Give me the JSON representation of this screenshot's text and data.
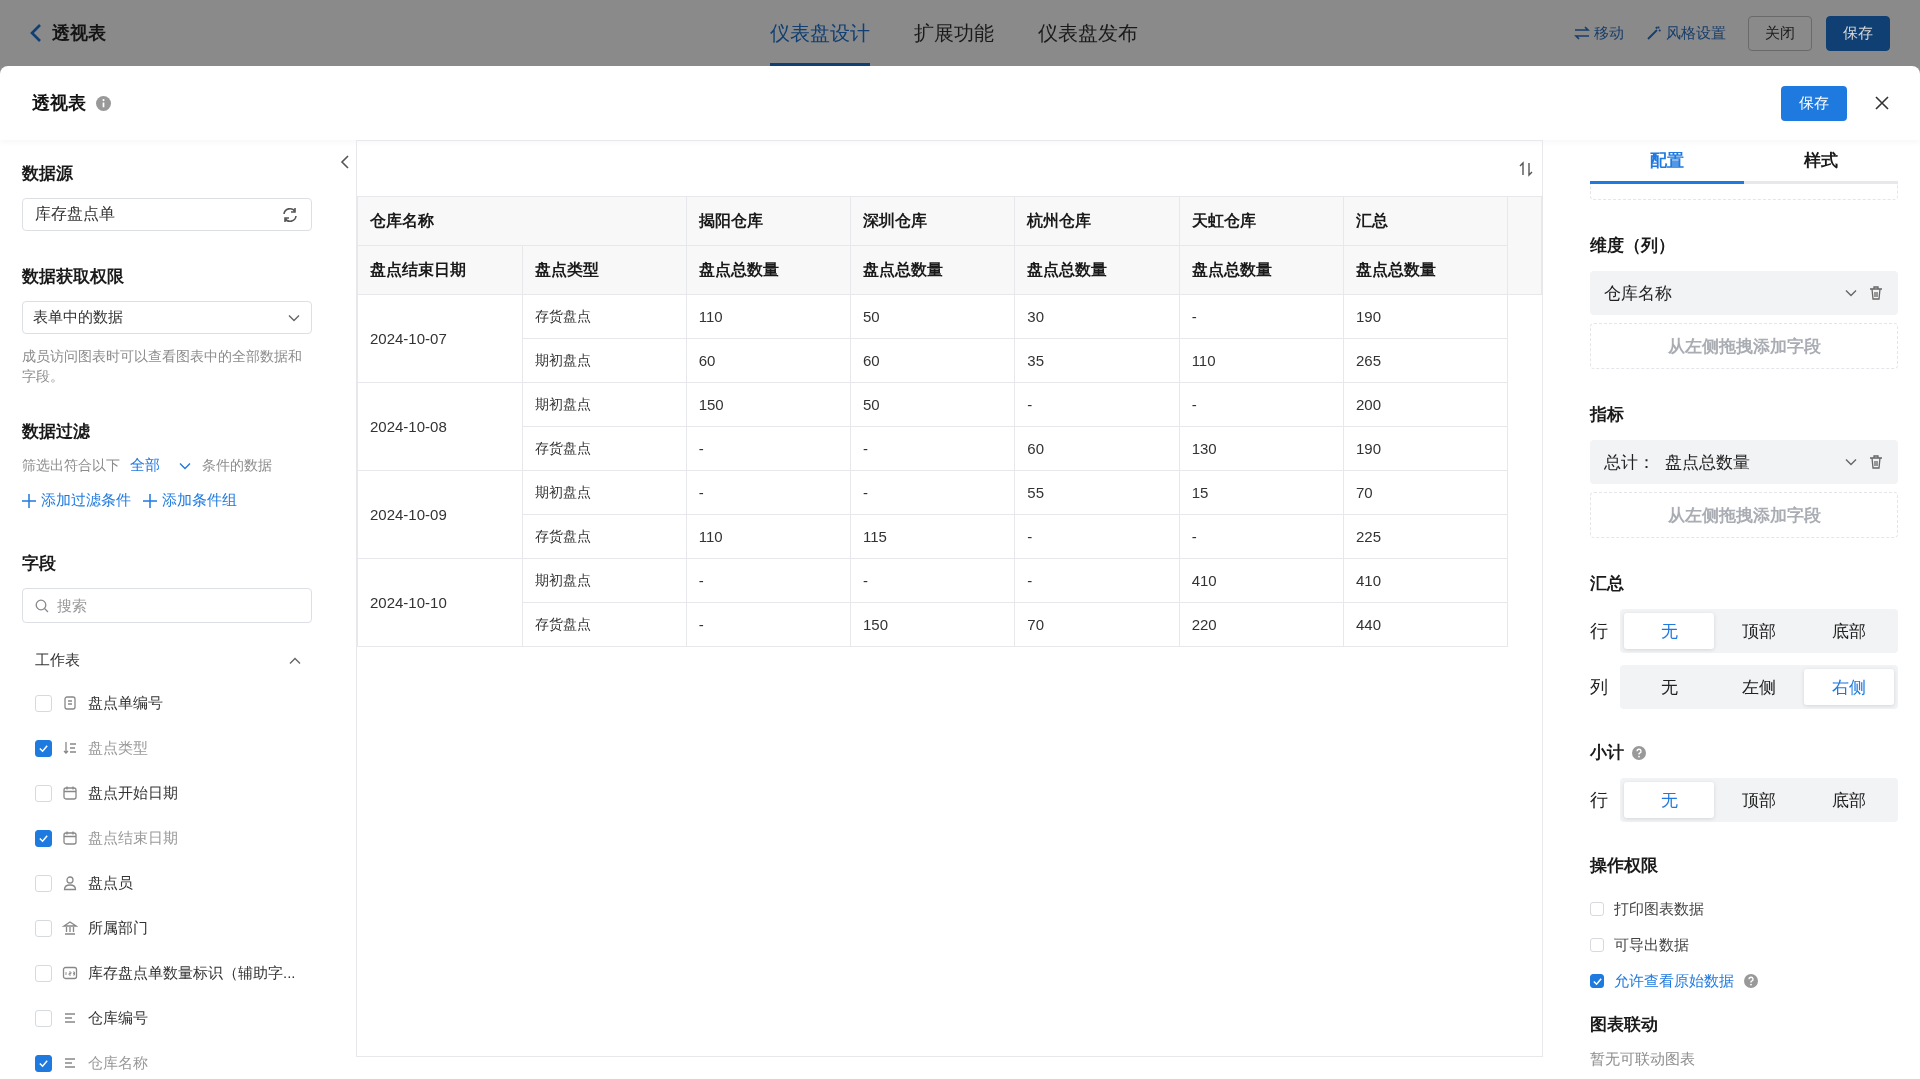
{
  "top_bar": {
    "title": "透视表",
    "tabs": [
      {
        "label": "仪表盘设计",
        "selected": true
      },
      {
        "label": "扩展功能",
        "selected": false
      },
      {
        "label": "仪表盘发布",
        "selected": false
      }
    ],
    "move_label": "移动",
    "style_label": "风格设置",
    "close_button": "关闭",
    "save_button": "保存"
  },
  "modal": {
    "title": "透视表",
    "save_button": "保存"
  },
  "data_source": {
    "label": "数据源",
    "value": "库存盘点单"
  },
  "permission": {
    "label": "数据获取权限",
    "value": "表单中的数据",
    "hint": "成员访问图表时可以查看图表中的全部数据和字段。"
  },
  "filter": {
    "label": "数据过滤",
    "prefix": "筛选出符合以下",
    "mode": "全部",
    "suffix": "条件的数据",
    "add_condition": "添加过滤条件",
    "add_group": "添加条件组"
  },
  "fields": {
    "label": "字段",
    "search_placeholder": "搜索",
    "group": {
      "name": "工作表",
      "expanded": true
    },
    "items": [
      {
        "name": "盘点单编号",
        "kind": "serial",
        "checked": false
      },
      {
        "name": "盘点类型",
        "kind": "option",
        "checked": true
      },
      {
        "name": "盘点开始日期",
        "kind": "date",
        "checked": false
      },
      {
        "name": "盘点结束日期",
        "kind": "date",
        "checked": true
      },
      {
        "name": "盘点员",
        "kind": "member",
        "checked": false
      },
      {
        "name": "所属部门",
        "kind": "department",
        "checked": false
      },
      {
        "name": "库存盘点单数量标识（辅助字...",
        "kind": "number",
        "checked": false
      },
      {
        "name": "仓库编号",
        "kind": "text",
        "checked": false
      },
      {
        "name": "仓库名称",
        "kind": "text",
        "checked": true
      }
    ]
  },
  "table": {
    "column_header": [
      "仓库名称",
      "揭阳仓库",
      "深圳仓库",
      "杭州仓库",
      "天虹仓库",
      "汇总"
    ],
    "row_header": [
      "盘点结束日期",
      "盘点类型",
      "盘点总数量",
      "盘点总数量",
      "盘点总数量",
      "盘点总数量",
      "盘点总数量"
    ],
    "groups": [
      {
        "date": "2024-10-07",
        "rows": [
          {
            "type": "存货盘点",
            "values": [
              "110",
              "50",
              "30",
              "-",
              "190"
            ]
          },
          {
            "type": "期初盘点",
            "values": [
              "60",
              "60",
              "35",
              "110",
              "265"
            ]
          }
        ]
      },
      {
        "date": "2024-10-08",
        "rows": [
          {
            "type": "期初盘点",
            "values": [
              "150",
              "50",
              "-",
              "-",
              "200"
            ]
          },
          {
            "type": "存货盘点",
            "values": [
              "-",
              "-",
              "60",
              "130",
              "190"
            ]
          }
        ]
      },
      {
        "date": "2024-10-09",
        "rows": [
          {
            "type": "期初盘点",
            "values": [
              "-",
              "-",
              "55",
              "15",
              "70"
            ]
          },
          {
            "type": "存货盘点",
            "values": [
              "110",
              "115",
              "-",
              "-",
              "225"
            ]
          }
        ]
      },
      {
        "date": "2024-10-10",
        "rows": [
          {
            "type": "期初盘点",
            "values": [
              "-",
              "-",
              "-",
              "410",
              "410"
            ]
          },
          {
            "type": "存货盘点",
            "values": [
              "-",
              "150",
              "70",
              "220",
              "440"
            ]
          }
        ]
      }
    ]
  },
  "config_tabs": [
    {
      "label": "配置",
      "selected": true
    },
    {
      "label": "样式",
      "selected": false
    }
  ],
  "dimension": {
    "label": "维度（列）",
    "field": "仓库名称",
    "drop_hint": "从左侧拖拽添加字段"
  },
  "metric": {
    "label": "指标",
    "prefix": "总计：",
    "field": "盘点总数量",
    "drop_hint": "从左侧拖拽添加字段"
  },
  "totals": {
    "label": "汇总",
    "rows": [
      {
        "label": "行",
        "options": [
          {
            "label": "无",
            "selected": true
          },
          {
            "label": "顶部",
            "selected": false
          },
          {
            "label": "底部",
            "selected": false
          }
        ]
      },
      {
        "label": "列",
        "options": [
          {
            "label": "无",
            "selected": false
          },
          {
            "label": "左侧",
            "selected": false
          },
          {
            "label": "右侧",
            "selected": true
          }
        ]
      }
    ]
  },
  "subtotal": {
    "label": "小计",
    "rows": [
      {
        "label": "行",
        "options": [
          {
            "label": "无",
            "selected": true
          },
          {
            "label": "顶部",
            "selected": false
          },
          {
            "label": "底部",
            "selected": false
          }
        ]
      }
    ]
  },
  "operations": {
    "label": "操作权限",
    "items": [
      {
        "label": "打印图表数据",
        "checked": false,
        "help": false
      },
      {
        "label": "可导出数据",
        "checked": false,
        "help": false
      },
      {
        "label": "允许查看原始数据",
        "checked": true,
        "help": true
      }
    ]
  },
  "linkage": {
    "label": "图表联动",
    "note": "暂无可联动图表"
  }
}
